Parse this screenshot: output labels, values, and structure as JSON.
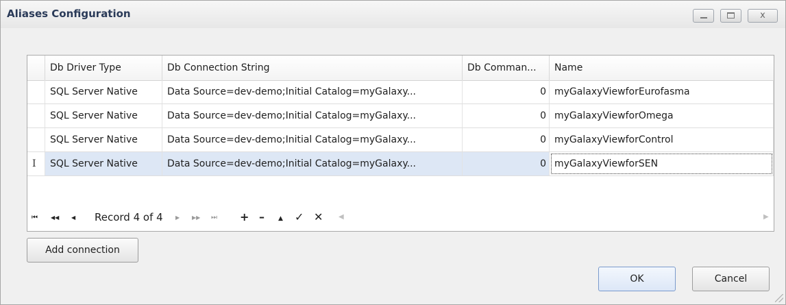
{
  "window": {
    "title": "Aliases Configuration",
    "controls": {
      "minimize": "",
      "maximize": "",
      "close": "x"
    }
  },
  "grid": {
    "columns": [
      "",
      "Db Driver Type",
      "Db Connection String",
      "Db Comman...",
      "Name"
    ],
    "rows": [
      {
        "indicator": "",
        "driver": "SQL Server Native",
        "connection": "Data Source=dev-demo;Initial Catalog=myGalaxy...",
        "command": "0",
        "name": "myGalaxyViewforEurofasma"
      },
      {
        "indicator": "",
        "driver": "SQL Server Native",
        "connection": "Data Source=dev-demo;Initial Catalog=myGalaxy...",
        "command": "0",
        "name": "myGalaxyViewforOmega"
      },
      {
        "indicator": "",
        "driver": "SQL Server Native",
        "connection": "Data Source=dev-demo;Initial Catalog=myGalaxy...",
        "command": "0",
        "name": "myGalaxyViewforControl"
      },
      {
        "indicator": "I",
        "driver": "SQL Server Native",
        "connection": "Data Source=dev-demo;Initial Catalog=myGalaxy...",
        "command": "0",
        "name": "myGalaxyViewforSEN"
      }
    ],
    "navigator": {
      "first": "⏮",
      "prev_page": "◀◀",
      "prev": "◀",
      "record_text": "Record 4 of 4",
      "next": "▶",
      "next_page": "▶▶",
      "last": "⏭",
      "append": "+",
      "remove": "–",
      "edit": "▲",
      "end_edit": "✓",
      "cancel_edit": "✕"
    }
  },
  "buttons": {
    "add_connection": "Add connection",
    "ok": "OK",
    "cancel": "Cancel"
  }
}
